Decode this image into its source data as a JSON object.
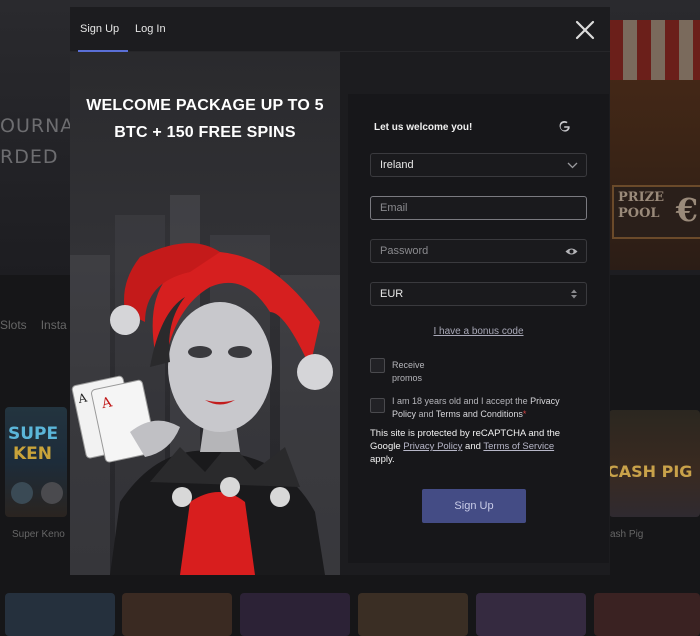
{
  "background": {
    "hero_line1": "OURNAM",
    "hero_line2": "RDED",
    "prize_line1": "PRIZE",
    "prize_line2": "POOL",
    "prize_symbol": "€",
    "category_tabs": [
      "Slots",
      "Insta"
    ],
    "game_left_label": "Super Keno",
    "game_left_title_top": "SUPE",
    "game_left_title_bottom": "KEN",
    "game_right_label": "ash Pig",
    "game_right_title": "CASH PIG"
  },
  "modal": {
    "tabs": [
      {
        "label": "Sign Up",
        "active": true
      },
      {
        "label": "Log In",
        "active": false
      }
    ],
    "promo_title": "WELCOME PACKAGE UP TO 5 BTC + 150 FREE SPINS",
    "form": {
      "welcome": "Let us welcome you!",
      "country": "Ireland",
      "email_placeholder": "Email",
      "password_placeholder": "Password",
      "currency": "EUR",
      "bonus_link": "I have a bonus code",
      "receive_promos": "Receive promos",
      "age_text_1": "I am 18 years old and I accept the ",
      "privacy_policy": "Privacy Policy",
      "age_and": " and ",
      "terms_conditions": "Terms and Conditions",
      "required_mark": "*",
      "recaptcha_1": "This site is protected by reCAPTCHA and the Google ",
      "recaptcha_privacy": "Privacy Policy",
      "recaptcha_and": " and ",
      "recaptcha_terms": "Terms of Service",
      "recaptcha_end": " apply.",
      "submit": "Sign Up"
    }
  },
  "colors": {
    "accent": "#5a6fd6",
    "button": "#444c85",
    "required": "#d04040"
  }
}
